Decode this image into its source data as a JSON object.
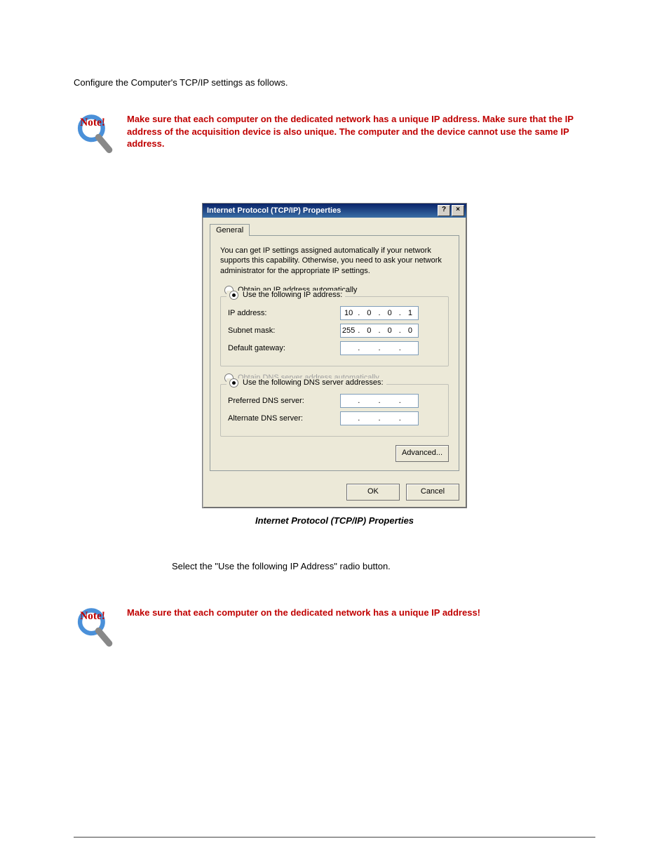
{
  "doc": {
    "intro": "Configure the Computer's TCP/IP settings as follows.",
    "note1": "Make sure that each computer on the dedicated network has a unique IP address.  Make sure that the IP address of the acquisition device is also unique.  The computer and the device cannot use the same IP address.",
    "caption": "Internet Protocol (TCP/IP) Properties",
    "instruction2": "Select the \"Use the following IP Address\" radio button.",
    "note2": "Make sure that each computer on the dedicated network has a unique IP address!"
  },
  "dialog": {
    "title": "Internet Protocol (TCP/IP) Properties",
    "help_glyph": "?",
    "close_glyph": "×",
    "tab": "General",
    "desc": "You can get IP settings assigned automatically if your network supports this capability. Otherwise, you need to ask your network administrator for the appropriate IP settings.",
    "radio_auto_ip": "Obtain an IP address automatically",
    "radio_use_ip": "Use the following IP address:",
    "lbl_ip": "IP address:",
    "lbl_subnet": "Subnet mask:",
    "lbl_gateway": "Default gateway:",
    "ip": {
      "a": "10",
      "b": "0",
      "c": "0",
      "d": "1"
    },
    "subnet": {
      "a": "255",
      "b": "0",
      "c": "0",
      "d": "0"
    },
    "gateway": {
      "a": "",
      "b": "",
      "c": "",
      "d": ""
    },
    "radio_auto_dns": "Obtain DNS server address automatically",
    "radio_use_dns": "Use the following DNS server addresses:",
    "lbl_pref_dns": "Preferred DNS server:",
    "lbl_alt_dns": "Alternate DNS server:",
    "pref_dns": {
      "a": "",
      "b": "",
      "c": "",
      "d": ""
    },
    "alt_dns": {
      "a": "",
      "b": "",
      "c": "",
      "d": ""
    },
    "btn_adv": "Advanced...",
    "btn_ok": "OK",
    "btn_cancel": "Cancel"
  }
}
